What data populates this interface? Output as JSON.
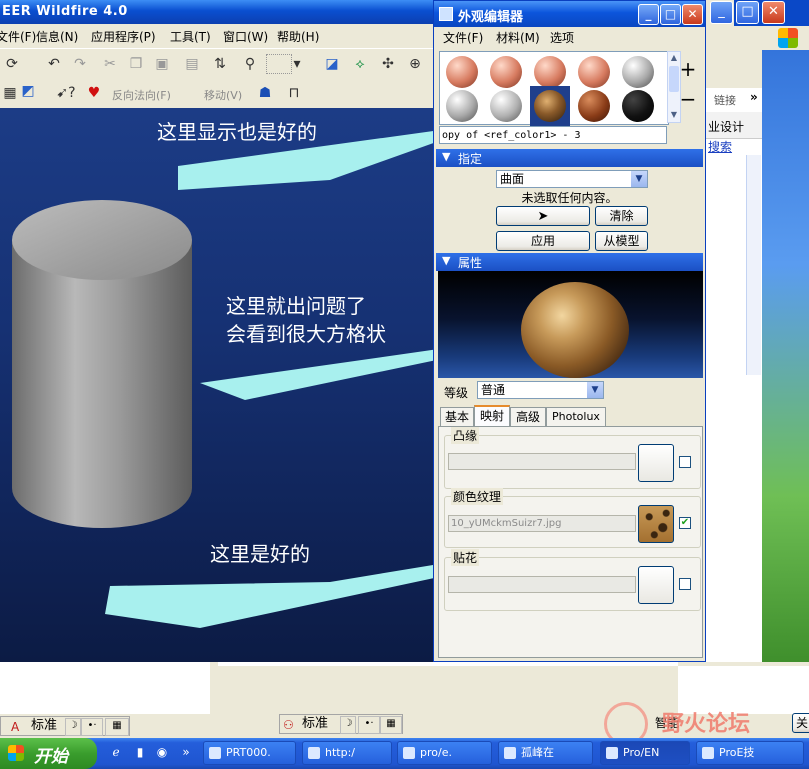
{
  "cad": {
    "title": "EER Wildfire 4.0",
    "menu": [
      "文件(F)",
      "信息(N)",
      "应用程序(P)",
      "工具(T)",
      "窗口(W)",
      "帮助(H)"
    ],
    "toolbar2": {
      "reverse_normal": "反向法向(F)",
      "move": "移动(V)"
    }
  },
  "annotations": {
    "top": "这里显示也是好的",
    "middle_line1": "这里就出问题了",
    "middle_line2": "会看到很大方格状",
    "bottom": "这里是好的"
  },
  "editor": {
    "title": "外观编辑器",
    "menu": [
      "文件(F)",
      "材料(M)",
      "选项"
    ],
    "appearance_name": "opy of <ref_color1> - 3",
    "assign": {
      "header": "指定",
      "type_value": "曲面",
      "status": "未选取任何内容。",
      "clear": "清除",
      "apply": "应用",
      "from_model": "从模型"
    },
    "properties": {
      "header": "属性",
      "level_label": "等级",
      "level_value": "普通",
      "tabs": [
        "基本",
        "映射",
        "高级",
        "Photolux"
      ],
      "active_tab": "映射",
      "bump": "凸缘",
      "color_texture": "颜色纹理",
      "texture_file": "10_yUMckmSuizr7.jpg",
      "decal": "贴花"
    }
  },
  "right_window": {
    "link": "链接",
    "design": "业设计",
    "search": "搜索"
  },
  "bottom_lang": "标准",
  "bottom_right_text": "智能",
  "bottom_right_btn": "关",
  "taskbar": {
    "start": "开始",
    "tasks": [
      "PRT000.",
      "http:/",
      "pro/e.",
      "孤峰在",
      "Pro/EN",
      "ProE技"
    ],
    "active_task": "Pro/EN"
  },
  "watermark": "野火论坛",
  "icon_names": [
    "undo-icon",
    "redo-icon",
    "cut-icon",
    "copy-icon",
    "paste-icon",
    "find-icon",
    "help-icon",
    "heart-icon",
    "plus-icon",
    "minus-icon",
    "windows-flag-icon"
  ]
}
